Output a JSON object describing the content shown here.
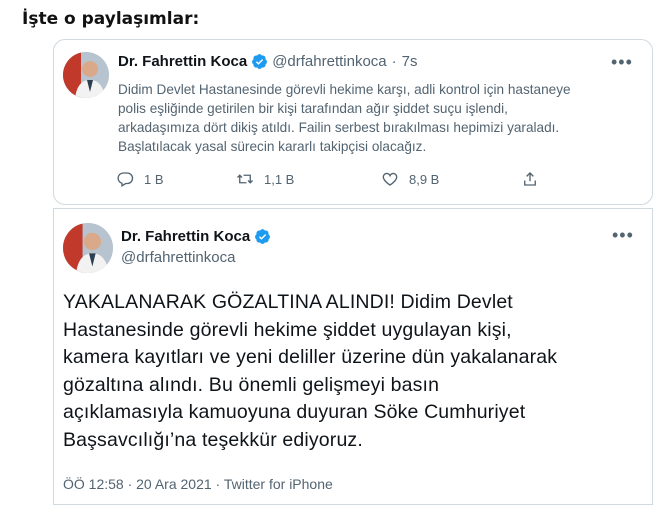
{
  "headline": "İşte o paylaşımlar:",
  "tweet1": {
    "author_name": "Dr. Fahrettin Koca",
    "handle": "@drfahrettinkoca",
    "separator": "·",
    "time": "7s",
    "text_lines": [
      "Didim Devlet Hastanesinde görevli hekime karşı, adli kontrol için hastaneye",
      "polis eşliğinde getirilen bir kişi tarafından ağır şiddet suçu işlendi,",
      "arkadaşımıza dört dikiş atıldı. Failin serbest bırakılması hepimizi yaraladı.",
      "Başlatılacak yasal sürecin kararlı takipçisi olacağız."
    ],
    "replies": "1 B",
    "retweets": "1,1 B",
    "likes": "8,9 B"
  },
  "tweet2": {
    "author_name": "Dr. Fahrettin Koca",
    "handle": "@drfahrettinkoca",
    "text_lines": [
      "YAKALANARAK GÖZALTINA ALINDI! Didim Devlet",
      "Hastanesinde görevli hekime şiddet uygulayan kişi,",
      "kamera kayıtları ve yeni deliller üzerine dün yakalanarak",
      "gözaltına alındı. Bu önemli gelişmeyi basın",
      "açıklamasıyla kamuoyuna duyuran Söke Cumhuriyet",
      "Başsavcılığı’na teşekkür ediyoruz."
    ],
    "meta": "ÖÖ 12:58 · 20 Ara 2021 · Twitter for iPhone"
  },
  "colors": {
    "verified": "#1d9bf0",
    "text": "#0f1419",
    "muted": "#536471",
    "border": "#cfd9de"
  },
  "icons": [
    "verified-badge-icon",
    "more-icon",
    "reply-icon",
    "retweet-icon",
    "like-icon",
    "share-icon"
  ]
}
